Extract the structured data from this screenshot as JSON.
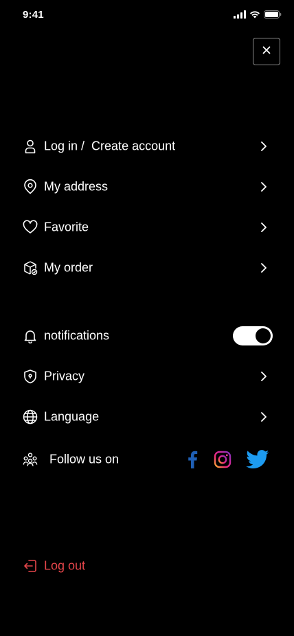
{
  "status_bar": {
    "time": "9:41"
  },
  "menu": {
    "items": [
      {
        "label": "Log in /  Create account"
      },
      {
        "label": "My address"
      },
      {
        "label": "Favorite"
      },
      {
        "label": "My order"
      }
    ]
  },
  "settings": {
    "notifications_label": "notifications",
    "notifications_enabled": true,
    "privacy_label": "Privacy",
    "language_label": "Language",
    "follow_label": "Follow us on"
  },
  "logout": {
    "label": "Log out",
    "color": "#e6464b"
  },
  "colors": {
    "background": "#000000",
    "text": "#ffffff",
    "facebook": "#1f5fb4",
    "twitter": "#1d9bf0"
  }
}
